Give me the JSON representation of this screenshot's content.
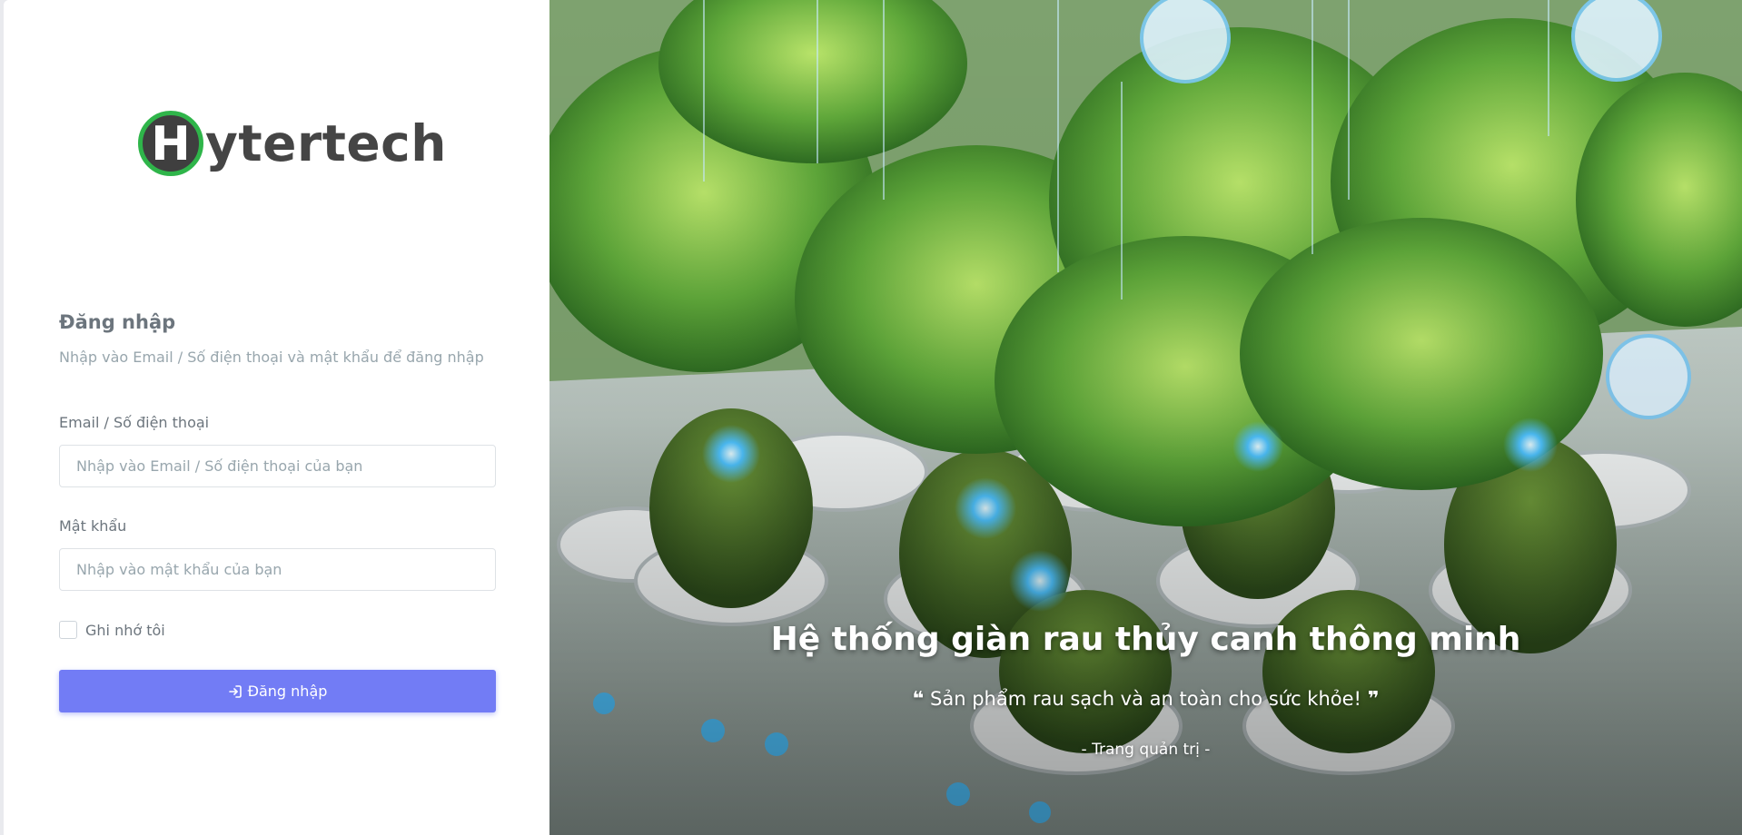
{
  "brand": {
    "logo_mark": "H",
    "logo_text": "ytertech",
    "mark_color": "#2fb54a"
  },
  "form": {
    "title": "Đăng nhập",
    "subtitle": "Nhập vào Email / Số điện thoại và mật khẩu để đăng nhập",
    "email_label": "Email / Số điện thoại",
    "email_placeholder": "Nhập vào Email / Số điện thoại của bạn",
    "password_label": "Mật khẩu",
    "password_placeholder": "Nhập vào mật khẩu của bạn",
    "remember_label": "Ghi nhớ tôi",
    "submit_label": "Đăng nhập",
    "submit_icon": "login-icon",
    "accent_color": "#727cf5"
  },
  "hero": {
    "title": "Hệ thống giàn rau thủy canh thông minh",
    "quote_open": "❝",
    "quote": "Sản phẩm rau sạch và an toàn cho sức khỏe!",
    "quote_close": "❞",
    "author": "- Trang quản trị -"
  }
}
